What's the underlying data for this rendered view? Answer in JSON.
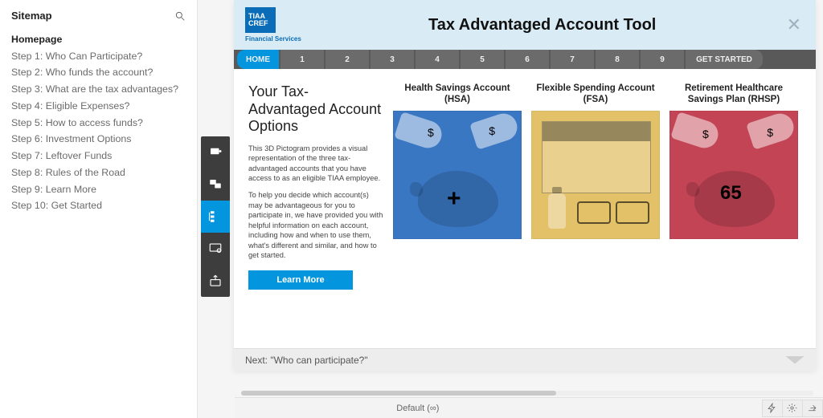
{
  "sidebar": {
    "title": "Sitemap",
    "items": [
      "Homepage",
      "Step 1: Who Can Participate?",
      "Step 2: Who funds the account?",
      "Step 3: What are the tax advantages?",
      "Step 4: Eligible Expenses?",
      "Step 5: How to access funds?",
      "Step 6: Investment Options",
      "Step 7: Leftover Funds",
      "Step 8: Rules of the Road",
      "Step 9: Learn More",
      "Step 10: Get Started"
    ],
    "active_index": 0
  },
  "app": {
    "logo_line1": "TIAA",
    "logo_line2": "CREF",
    "logo_caption": "Financial Services",
    "title": "Tax Advantaged Account Tool"
  },
  "nav": {
    "home": "HOME",
    "steps": [
      "1",
      "2",
      "3",
      "4",
      "5",
      "6",
      "7",
      "8",
      "9"
    ],
    "get_started": "GET STARTED"
  },
  "intro": {
    "heading": "Your Tax-Advantaged Account Options",
    "p1": "This 3D Pictogram provides a visual representation of the three tax-advantaged accounts that you have access to as an eligible TIAA employee.",
    "p2": "To help you decide which account(s) may be advantageous for you to participate in, we have provided you with helpful information on each account, including how and when to use them, what's different and similar, and how to get started.",
    "learn_more": "Learn More"
  },
  "cards": [
    {
      "title": "Health Savings Account (HSA)"
    },
    {
      "title": "Flexible Spending Account (FSA)"
    },
    {
      "title": "Retirement Healthcare Savings Plan (RHSP)"
    }
  ],
  "footer": {
    "next": "Next: \"Who can participate?\""
  },
  "status": {
    "device": "Default (∞)"
  }
}
